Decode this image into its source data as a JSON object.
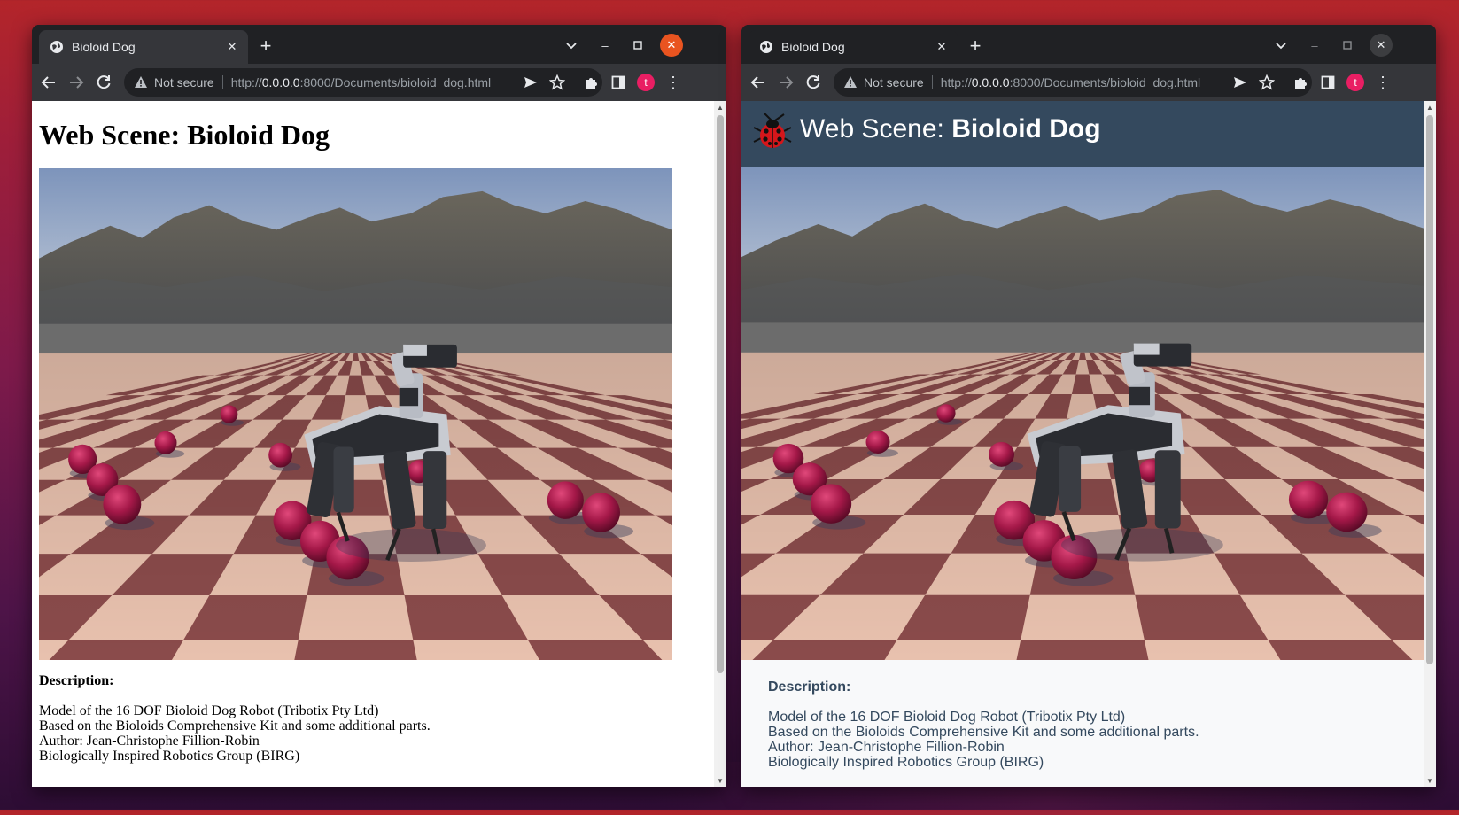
{
  "colors": {
    "page_bg": "#b3252a",
    "header_bg": "#34495e",
    "avatar": "#e91e63",
    "close_accent": "#e95420"
  },
  "windows": [
    {
      "tab_title": "Bioloid Dog",
      "security_label": "Not secure",
      "url_prefix": "http://",
      "url_host": "0.0.0.0",
      "url_rest": ":8000/Documents/bioloid_dog.html",
      "avatar_letter": "t",
      "page": {
        "title": "Web Scene: Bioloid Dog",
        "description_label": "Description:",
        "description_lines": [
          "Model of the 16 DOF Bioloid Dog Robot (Tribotix Pty Ltd)",
          "Based on the Bioloids Comprehensive Kit and some additional parts.",
          "Author: Jean-Christophe Fillion-Robin",
          "Biologically Inspired Robotics Group (BIRG)"
        ]
      }
    },
    {
      "tab_title": "Bioloid Dog",
      "security_label": "Not secure",
      "url_prefix": "http://",
      "url_host": "0.0.0.0",
      "url_rest": ":8000/Documents/bioloid_dog.html",
      "avatar_letter": "t",
      "page": {
        "title_prefix": "Web Scene: ",
        "title_bold": "Bioloid Dog",
        "description_label": "Description:",
        "description_lines": [
          "Model of the 16 DOF Bioloid Dog Robot (Tribotix Pty Ltd)",
          "Based on the Bioloids Comprehensive Kit and some additional parts.",
          "Author: Jean-Christophe Fillion-Robin",
          "Biologically Inspired Robotics Group (BIRG)"
        ]
      }
    }
  ],
  "icons": {
    "favicon": "globe-icon",
    "tab_close": "close-icon",
    "new_tab": "plus-icon",
    "tab_search": "chevron-down-icon",
    "back": "arrow-left-icon",
    "forward": "arrow-right-icon",
    "reload": "reload-icon",
    "warning": "warning-icon",
    "share": "send-icon",
    "bookmark": "star-icon",
    "extensions": "puzzle-icon",
    "side_panel": "side-panel-icon",
    "menu": "kebab-menu-icon",
    "logo": "ladybug-icon"
  }
}
